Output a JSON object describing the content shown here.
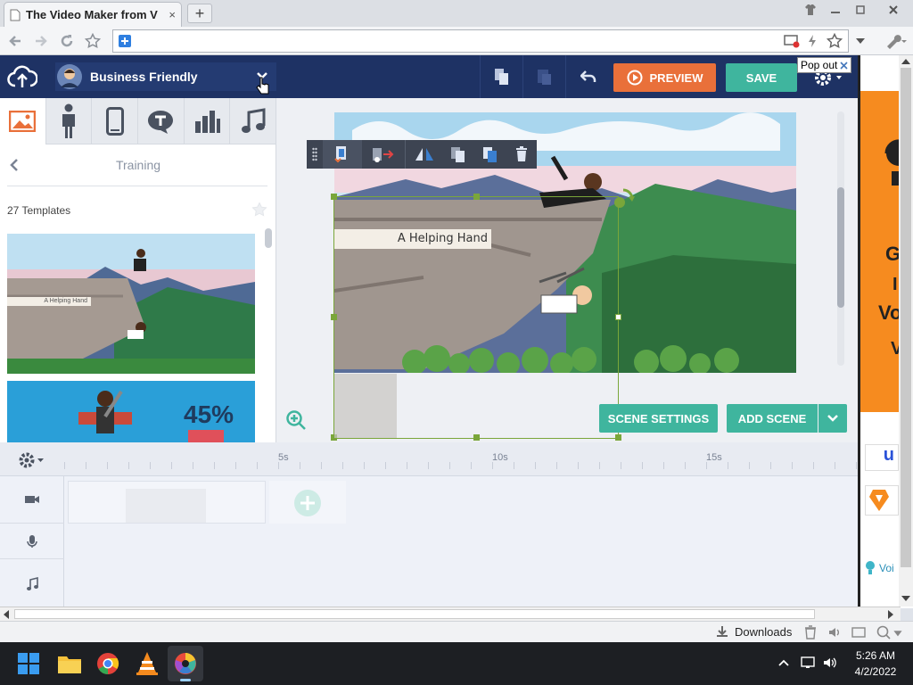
{
  "browser": {
    "tab_title": "The Video Maker from V",
    "tab_close": "×",
    "new_tab": "+",
    "popout_label": "Pop out",
    "downloads_label": "Downloads"
  },
  "app": {
    "theme_name": "Business Friendly",
    "preview_label": "PREVIEW",
    "save_label": "SAVE",
    "scene_settings_label": "SCENE SETTINGS",
    "add_scene_label": "ADD SCENE",
    "breadcrumb": "Training",
    "templates_count": "27 Templates",
    "template_1_caption": "A Helping Hand",
    "template_2_stat": "45%",
    "scene_text": "A Helping Hand",
    "timeline_marks": [
      "5s",
      "10s",
      "15s"
    ]
  },
  "ad": {
    "letters": [
      "G",
      "I",
      "Vo",
      "V"
    ]
  },
  "ad_snippet": "Voi",
  "taskbar": {
    "time": "5:26 AM",
    "date": "4/2/2022"
  },
  "colors": {
    "topbar": "#1e3264",
    "preview": "#e9703a",
    "save": "#3fb59e",
    "accent": "#3fb59e"
  }
}
